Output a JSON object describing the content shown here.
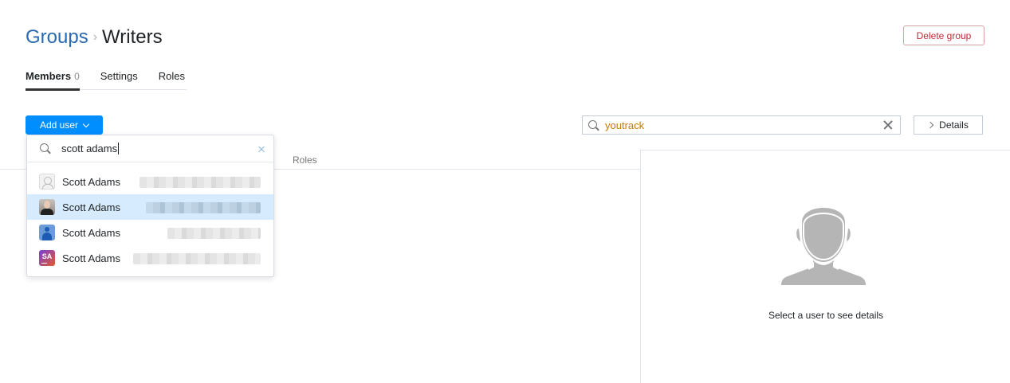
{
  "breadcrumb": {
    "parent": "Groups",
    "separator": "›",
    "current": "Writers"
  },
  "actions": {
    "delete_group": "Delete group",
    "add_user": "Add user",
    "details": "Details"
  },
  "tabs": [
    {
      "label": "Members",
      "count": "0"
    },
    {
      "label": "Settings"
    },
    {
      "label": "Roles"
    }
  ],
  "table": {
    "col_roles": "Roles"
  },
  "search": {
    "value": "youtrack"
  },
  "dropdown": {
    "query": "scott adams",
    "items": [
      {
        "name": "Scott Adams",
        "avatar": "default-user-icon"
      },
      {
        "name": "Scott Adams",
        "avatar": "photo-avatar"
      },
      {
        "name": "Scott Adams",
        "avatar": "blue-user-icon"
      },
      {
        "name": "Scott Adams",
        "avatar": "SA"
      }
    ]
  },
  "details_panel": {
    "message": "Select a user to see details"
  },
  "colors": {
    "primary": "#008eff",
    "link": "#2a6ab0",
    "danger": "#c22a39",
    "search_text": "#c77b00",
    "highlight": "#d6ebfd"
  }
}
